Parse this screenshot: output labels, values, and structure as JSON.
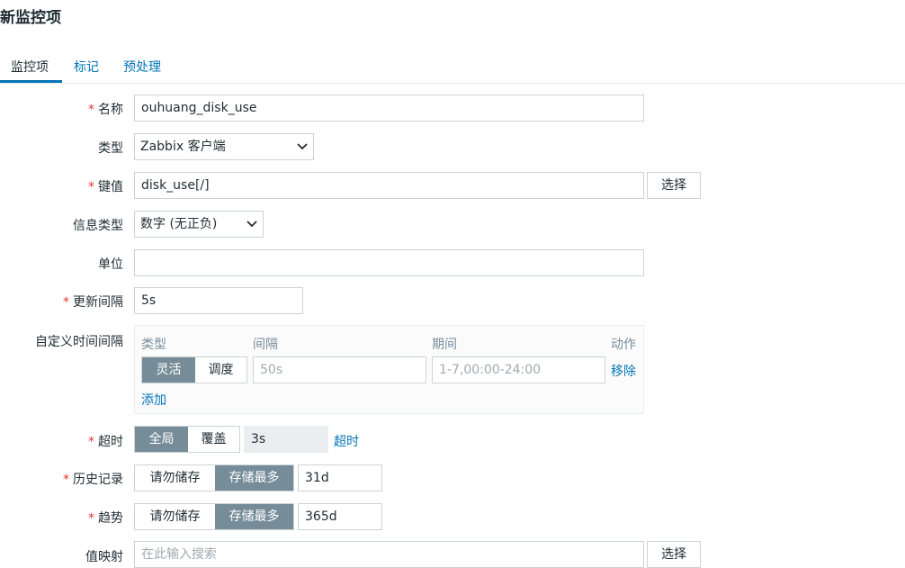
{
  "page": {
    "title": "新监控项"
  },
  "tabs": [
    {
      "label": "监控项",
      "active": true
    },
    {
      "label": "标记",
      "active": false
    },
    {
      "label": "预处理",
      "active": false
    }
  ],
  "form": {
    "name": {
      "label": "名称",
      "required": true,
      "value": "ouhuang_disk_use"
    },
    "type": {
      "label": "类型",
      "value": "Zabbix 客户端"
    },
    "key": {
      "label": "键值",
      "required": true,
      "value": "disk_use[/]",
      "button": "选择"
    },
    "info_type": {
      "label": "信息类型",
      "value": "数字 (无正负)"
    },
    "units": {
      "label": "单位",
      "value": ""
    },
    "update_interval": {
      "label": "更新间隔",
      "required": true,
      "value": "5s"
    },
    "custom_intervals": {
      "label": "自定义时间间隔",
      "headers": {
        "type": "类型",
        "interval": "间隔",
        "period": "期间",
        "action": "动作"
      },
      "row": {
        "type_options": [
          "灵活",
          "调度"
        ],
        "selected": "灵活",
        "interval_placeholder": "50s",
        "period_placeholder": "1-7,00:00-24:00",
        "remove": "移除"
      },
      "add": "添加"
    },
    "timeout": {
      "label": "超时",
      "required": true,
      "options": [
        "全局",
        "覆盖"
      ],
      "selected": "全局",
      "value": "3s",
      "link": "超时"
    },
    "history": {
      "label": "历史记录",
      "required": true,
      "options": [
        "请勿储存",
        "存储最多"
      ],
      "selected": "存储最多",
      "value": "31d"
    },
    "trends": {
      "label": "趋势",
      "required": true,
      "options": [
        "请勿储存",
        "存储最多"
      ],
      "selected": "存储最多",
      "value": "365d"
    },
    "value_map": {
      "label": "值映射",
      "placeholder": "在此输入搜索",
      "button": "选择"
    }
  },
  "colors": {
    "accent": "#0275b8",
    "required": "#e33734",
    "segment_active": "#768d99"
  },
  "icons": {
    "select_arrow": "chevron-down-icon"
  }
}
